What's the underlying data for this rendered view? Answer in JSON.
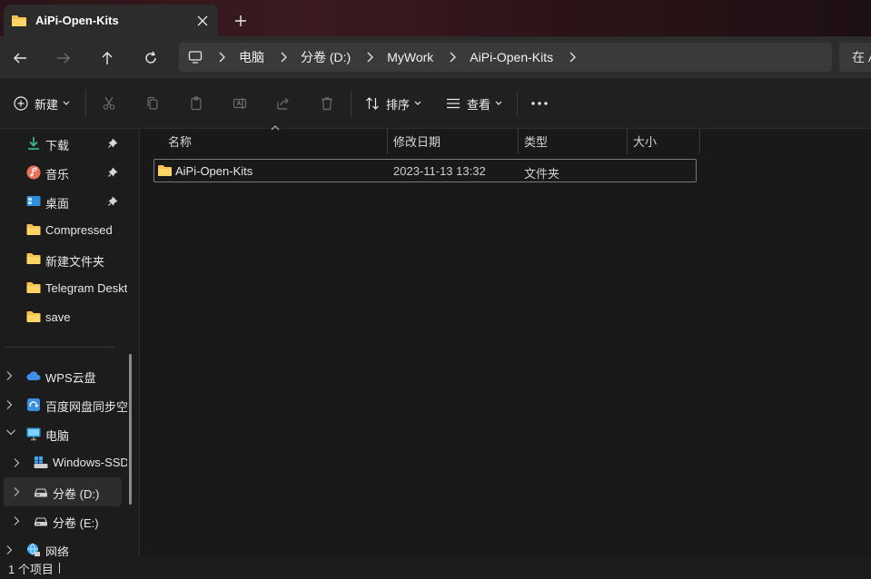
{
  "tab": {
    "title": "AiPi-Open-Kits",
    "close": "close-icon",
    "new_tab": "plus-icon"
  },
  "nav": {
    "back": "arrow-left-icon",
    "forward": "arrow-right-icon",
    "up": "arrow-up-icon",
    "refresh": "refresh-icon"
  },
  "address": {
    "breadcrumbs": [
      "电脑",
      "分卷 (D:)",
      "MyWork",
      "AiPi-Open-Kits"
    ],
    "search_placeholder": "在 A"
  },
  "toolbar": {
    "new_label": "新建",
    "sort_label": "排序",
    "view_label": "查看",
    "more": "more-icon"
  },
  "sidebar": {
    "quick_access": [
      {
        "label": "下载",
        "icon": "download-icon",
        "pinned": true
      },
      {
        "label": "音乐",
        "icon": "music-icon",
        "pinned": true
      },
      {
        "label": "桌面",
        "icon": "desktop-icon",
        "pinned": true
      },
      {
        "label": "Compressed",
        "icon": "folder-icon",
        "pinned": false
      },
      {
        "label": "新建文件夹",
        "icon": "folder-icon",
        "pinned": false
      },
      {
        "label": "Telegram Desktop",
        "icon": "folder-icon",
        "pinned": false
      },
      {
        "label": "save",
        "icon": "folder-icon",
        "pinned": false
      }
    ],
    "tree": [
      {
        "label": "WPS云盘",
        "icon": "cloud-icon"
      },
      {
        "label": "百度网盘同步空间",
        "icon": "baidu-sync-icon"
      },
      {
        "label": "电脑",
        "icon": "computer-icon"
      },
      {
        "label": "Windows-SSD",
        "icon": "windows-drive-icon"
      },
      {
        "label": "分卷 (D:)",
        "icon": "drive-icon"
      },
      {
        "label": "分卷 (E:)",
        "icon": "drive-icon"
      },
      {
        "label": "网络",
        "icon": "network-icon"
      }
    ]
  },
  "columns": {
    "name": "名称",
    "modified": "修改日期",
    "type": "类型",
    "size": "大小"
  },
  "files": [
    {
      "name": "AiPi-Open-Kits",
      "modified": "2023-11-13 13:32",
      "type": "文件夹",
      "size": ""
    }
  ],
  "status": {
    "count": "1 个项目"
  },
  "colors": {
    "folder": "#f6c04a",
    "background": "#191919",
    "toolbar": "#202020"
  }
}
